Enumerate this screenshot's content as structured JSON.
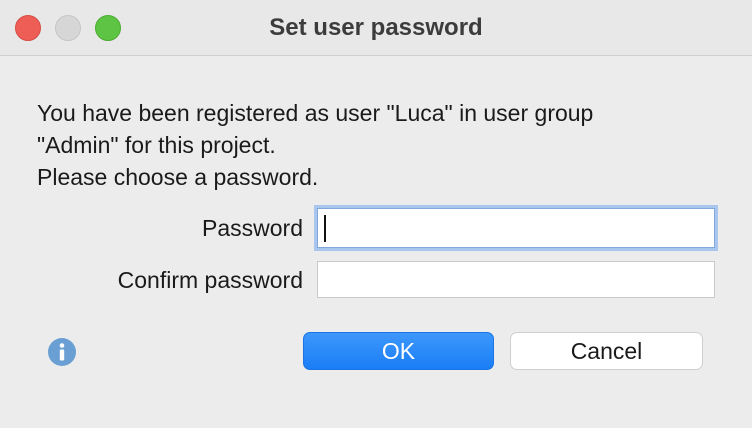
{
  "window": {
    "title": "Set user password"
  },
  "message": {
    "line1": "You have been registered as user \"Luca\" in user group",
    "line2": "\"Admin\" for this project.",
    "line3": "Please choose a password."
  },
  "form": {
    "password_label": "Password",
    "password_value": "",
    "confirm_label": "Confirm password",
    "confirm_value": ""
  },
  "buttons": {
    "ok_label": "OK",
    "cancel_label": "Cancel"
  },
  "icons": {
    "info": "info-icon"
  },
  "colors": {
    "accent": "#1a7ef6",
    "close": "#ee5e57",
    "zoom": "#5ec443",
    "info": "#6a9fd4"
  }
}
